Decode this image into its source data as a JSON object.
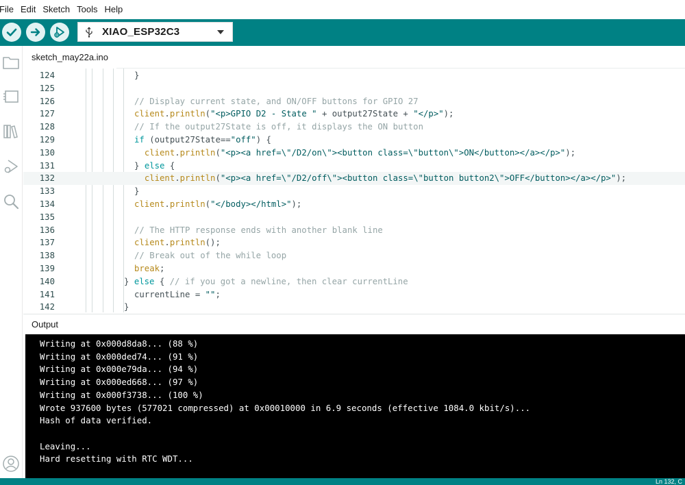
{
  "menu": {
    "file": "File",
    "edit": "Edit",
    "sketch": "Sketch",
    "tools": "Tools",
    "help": "Help"
  },
  "toolbar": {
    "verify_icon": "check-icon",
    "upload_icon": "arrow-right-icon",
    "debug_icon": "debug-icon",
    "board": "XIAO_ESP32C3"
  },
  "sidebar": {
    "icons": [
      "folder-icon",
      "board-manager-icon",
      "library-icon",
      "debug-icon",
      "search-icon",
      "account-icon"
    ]
  },
  "tab": {
    "label": "sketch_may22a.ino"
  },
  "editor": {
    "current_line": "132",
    "lines": [
      {
        "num": "124",
        "tokens": [
          {
            "t": "}",
            "c": "pl"
          }
        ]
      },
      {
        "num": "125",
        "tokens": []
      },
      {
        "num": "126",
        "tokens": [
          {
            "t": "// Display current state, and ON/OFF buttons for GPIO 27",
            "c": "com"
          }
        ]
      },
      {
        "num": "127",
        "tokens": [
          {
            "t": "client",
            "c": "fn"
          },
          {
            "t": ".",
            "c": "pl"
          },
          {
            "t": "println",
            "c": "fn"
          },
          {
            "t": "(",
            "c": "pl"
          },
          {
            "t": "\"<p>GPIO D2 - State \"",
            "c": "str"
          },
          {
            "t": " + output27State + ",
            "c": "pl"
          },
          {
            "t": "\"</p>\"",
            "c": "str"
          },
          {
            "t": ");",
            "c": "pl"
          }
        ]
      },
      {
        "num": "128",
        "tokens": [
          {
            "t": "// If the output27State is off, it displays the ON button",
            "c": "com"
          }
        ]
      },
      {
        "num": "129",
        "tokens": [
          {
            "t": "if",
            "c": "kw"
          },
          {
            "t": " (output27State==",
            "c": "pl"
          },
          {
            "t": "\"off\"",
            "c": "str"
          },
          {
            "t": ") {",
            "c": "pl"
          }
        ]
      },
      {
        "num": "130",
        "tokens": [
          {
            "t": "  ",
            "c": "pl"
          },
          {
            "t": "client",
            "c": "fn"
          },
          {
            "t": ".",
            "c": "pl"
          },
          {
            "t": "println",
            "c": "fn"
          },
          {
            "t": "(",
            "c": "pl"
          },
          {
            "t": "\"<p><a href=\\\"/D2/on\\\"><button class=\\\"button\\\">ON</button></a></p>\"",
            "c": "str"
          },
          {
            "t": ");",
            "c": "pl"
          }
        ]
      },
      {
        "num": "131",
        "tokens": [
          {
            "t": "} ",
            "c": "pl"
          },
          {
            "t": "else",
            "c": "kw"
          },
          {
            "t": " {",
            "c": "pl"
          }
        ]
      },
      {
        "num": "132",
        "tokens": [
          {
            "t": "  ",
            "c": "pl"
          },
          {
            "t": "client",
            "c": "fn"
          },
          {
            "t": ".",
            "c": "pl"
          },
          {
            "t": "println",
            "c": "fn"
          },
          {
            "t": "(",
            "c": "pl"
          },
          {
            "t": "\"<p><a href=\\\"/D2/off\\\"><button class=\\\"button button2\\\">OFF</button></a></p>\"",
            "c": "str"
          },
          {
            "t": ");",
            "c": "pl"
          }
        ]
      },
      {
        "num": "133",
        "tokens": [
          {
            "t": "}",
            "c": "pl"
          }
        ]
      },
      {
        "num": "134",
        "tokens": [
          {
            "t": "client",
            "c": "fn"
          },
          {
            "t": ".",
            "c": "pl"
          },
          {
            "t": "println",
            "c": "fn"
          },
          {
            "t": "(",
            "c": "pl"
          },
          {
            "t": "\"</body></html>\"",
            "c": "str"
          },
          {
            "t": ");",
            "c": "pl"
          }
        ]
      },
      {
        "num": "135",
        "tokens": []
      },
      {
        "num": "136",
        "tokens": [
          {
            "t": "// The HTTP response ends with another blank line",
            "c": "com"
          }
        ]
      },
      {
        "num": "137",
        "tokens": [
          {
            "t": "client",
            "c": "fn"
          },
          {
            "t": ".",
            "c": "pl"
          },
          {
            "t": "println",
            "c": "fn"
          },
          {
            "t": "();",
            "c": "pl"
          }
        ]
      },
      {
        "num": "138",
        "tokens": [
          {
            "t": "// Break out of the while loop",
            "c": "com"
          }
        ]
      },
      {
        "num": "139",
        "tokens": [
          {
            "t": "break",
            "c": "fn"
          },
          {
            "t": ";",
            "c": "pl"
          }
        ]
      },
      {
        "num": "140",
        "tokens": [
          {
            "t": "} ",
            "c": "pl"
          },
          {
            "t": "else",
            "c": "kw"
          },
          {
            "t": " { ",
            "c": "pl"
          },
          {
            "t": "// if you got a newline, then clear currentLine",
            "c": "com"
          }
        ]
      },
      {
        "num": "141",
        "tokens": [
          {
            "t": "currentLine = ",
            "c": "pl"
          },
          {
            "t": "\"\"",
            "c": "str"
          },
          {
            "t": ";",
            "c": "pl"
          }
        ]
      },
      {
        "num": "142",
        "tokens": [
          {
            "t": "}",
            "c": "pl"
          }
        ]
      }
    ]
  },
  "output": {
    "title": "Output",
    "lines": [
      "Writing at 0x000d8da8... (88 %)",
      "Writing at 0x000ded74... (91 %)",
      "Writing at 0x000e79da... (94 %)",
      "Writing at 0x000ed668... (97 %)",
      "Writing at 0x000f3738... (100 %)",
      "Wrote 937600 bytes (577021 compressed) at 0x00010000 in 6.9 seconds (effective 1084.0 kbit/s)...",
      "Hash of data verified.",
      "",
      "Leaving...",
      "Hard resetting with RTC WDT..."
    ]
  },
  "status": {
    "text": "Ln 132, C"
  },
  "colors": {
    "toolbar": "#008184",
    "button_bg": "#e2f3f3",
    "console_bg": "#000000"
  }
}
